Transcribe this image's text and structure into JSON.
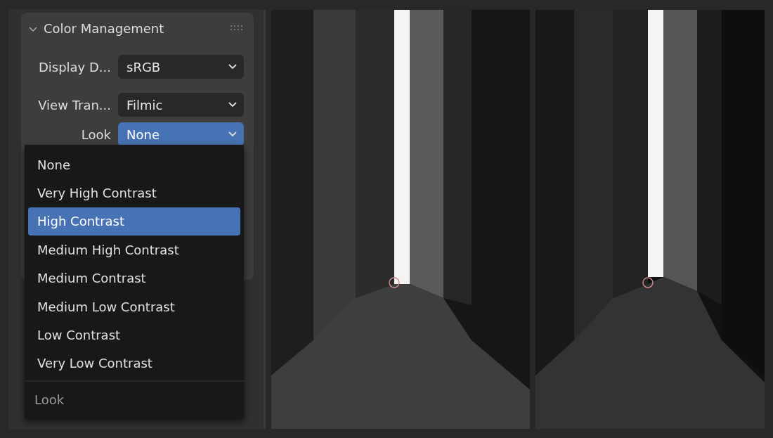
{
  "panel": {
    "title": "Color Management",
    "expanded": true,
    "fields": [
      {
        "label": "Display D...",
        "value": "sRGB",
        "active": false
      },
      {
        "label": "View Tran...",
        "value": "Filmic",
        "active": false
      },
      {
        "label": "Look",
        "value": "None",
        "active": true
      }
    ]
  },
  "dropdown": {
    "items": [
      {
        "label": "None",
        "selected": false
      },
      {
        "label": "Very High Contrast",
        "selected": false
      },
      {
        "label": "High Contrast",
        "selected": true
      },
      {
        "label": "Medium High Contrast",
        "selected": false
      },
      {
        "label": "Medium Contrast",
        "selected": false
      },
      {
        "label": "Medium Low Contrast",
        "selected": false
      },
      {
        "label": "Low Contrast",
        "selected": false
      },
      {
        "label": "Very Low Contrast",
        "selected": false
      }
    ],
    "footer": "Look"
  }
}
